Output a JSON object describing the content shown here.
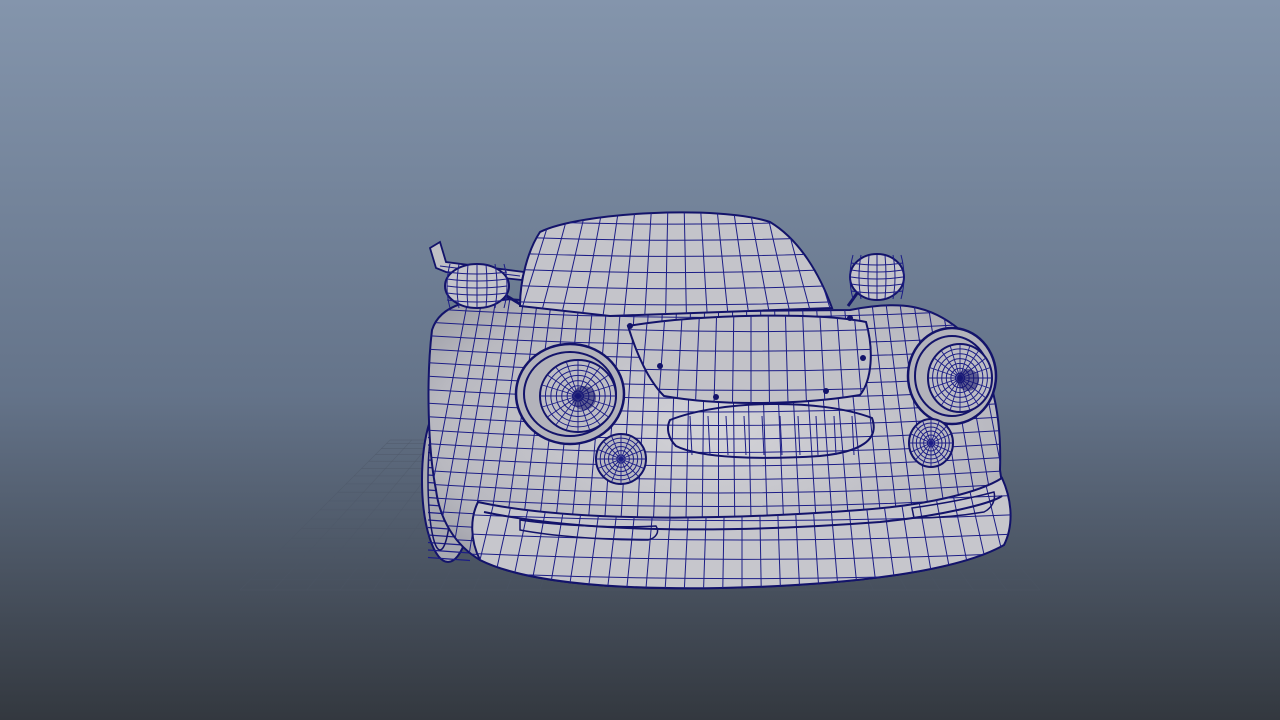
{
  "viewport": {
    "background_top": "#8495ac",
    "background_mid": "#647389",
    "background_bottom": "#33383f"
  },
  "model": {
    "surface_fill": "#bfbfc5",
    "wire_color": "#1c1d86",
    "wire_dark": "#13136a",
    "ground_grid_color": "#4d5666"
  }
}
